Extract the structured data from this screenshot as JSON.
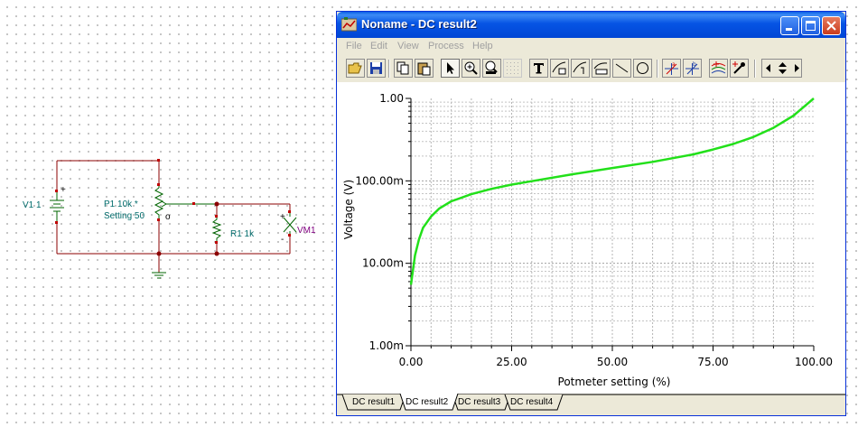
{
  "schematic": {
    "v1_label": "V1 1",
    "p1_label": "P1 10k *",
    "p1_setting": "Setting 50",
    "wiper_mark": "o",
    "r1_label": "R1 1k",
    "vm1_label": "VM1",
    "plus": "+",
    "minus": "-",
    "colors": {
      "wire": "#8b0000",
      "component": "#006400",
      "label": "#006b6b",
      "meter": "#800080"
    }
  },
  "window": {
    "title": "Noname - DC result2",
    "menu": [
      "File",
      "Edit",
      "View",
      "Process",
      "Help"
    ],
    "toolbar_icons": [
      "open-icon",
      "save-icon",
      "copy-icon",
      "paste-icon",
      "pointer-icon",
      "zoom-in-icon",
      "zoom-100-icon",
      "grid-icon",
      "text-icon",
      "curve-label-icon",
      "curve-label2-icon",
      "axis-label-icon",
      "line-icon",
      "ellipse-icon",
      "cursor-a-icon",
      "cursor-b-icon",
      "curves-icon",
      "eyedropper-icon",
      "arrows-icon"
    ],
    "tabs": [
      "DC result1",
      "DC result2",
      "DC result3",
      "DC result4"
    ],
    "active_tab": 1
  },
  "chart_data": {
    "type": "line",
    "xlabel": "Potmeter setting (%)",
    "ylabel": "Voltage (V)",
    "x_ticks": [
      "0.00",
      "25.00",
      "50.00",
      "75.00",
      "100.00"
    ],
    "y_ticks": [
      "1.00m",
      "10.00m",
      "100.00m",
      "1.00"
    ],
    "xlim": [
      0,
      100
    ],
    "ylim": [
      0.001,
      1
    ],
    "yscale": "log",
    "grid": true,
    "series": [
      {
        "color": "#22e01a",
        "x": [
          0,
          1,
          2,
          3,
          5,
          7,
          10,
          15,
          20,
          25,
          30,
          40,
          50,
          60,
          70,
          75,
          80,
          85,
          90,
          95,
          100
        ],
        "y": [
          0.0055,
          0.0125,
          0.0195,
          0.027,
          0.037,
          0.046,
          0.0565,
          0.069,
          0.08,
          0.09,
          0.099,
          0.12,
          0.143,
          0.17,
          0.209,
          0.24,
          0.28,
          0.34,
          0.44,
          0.62,
          1.0
        ]
      }
    ]
  }
}
